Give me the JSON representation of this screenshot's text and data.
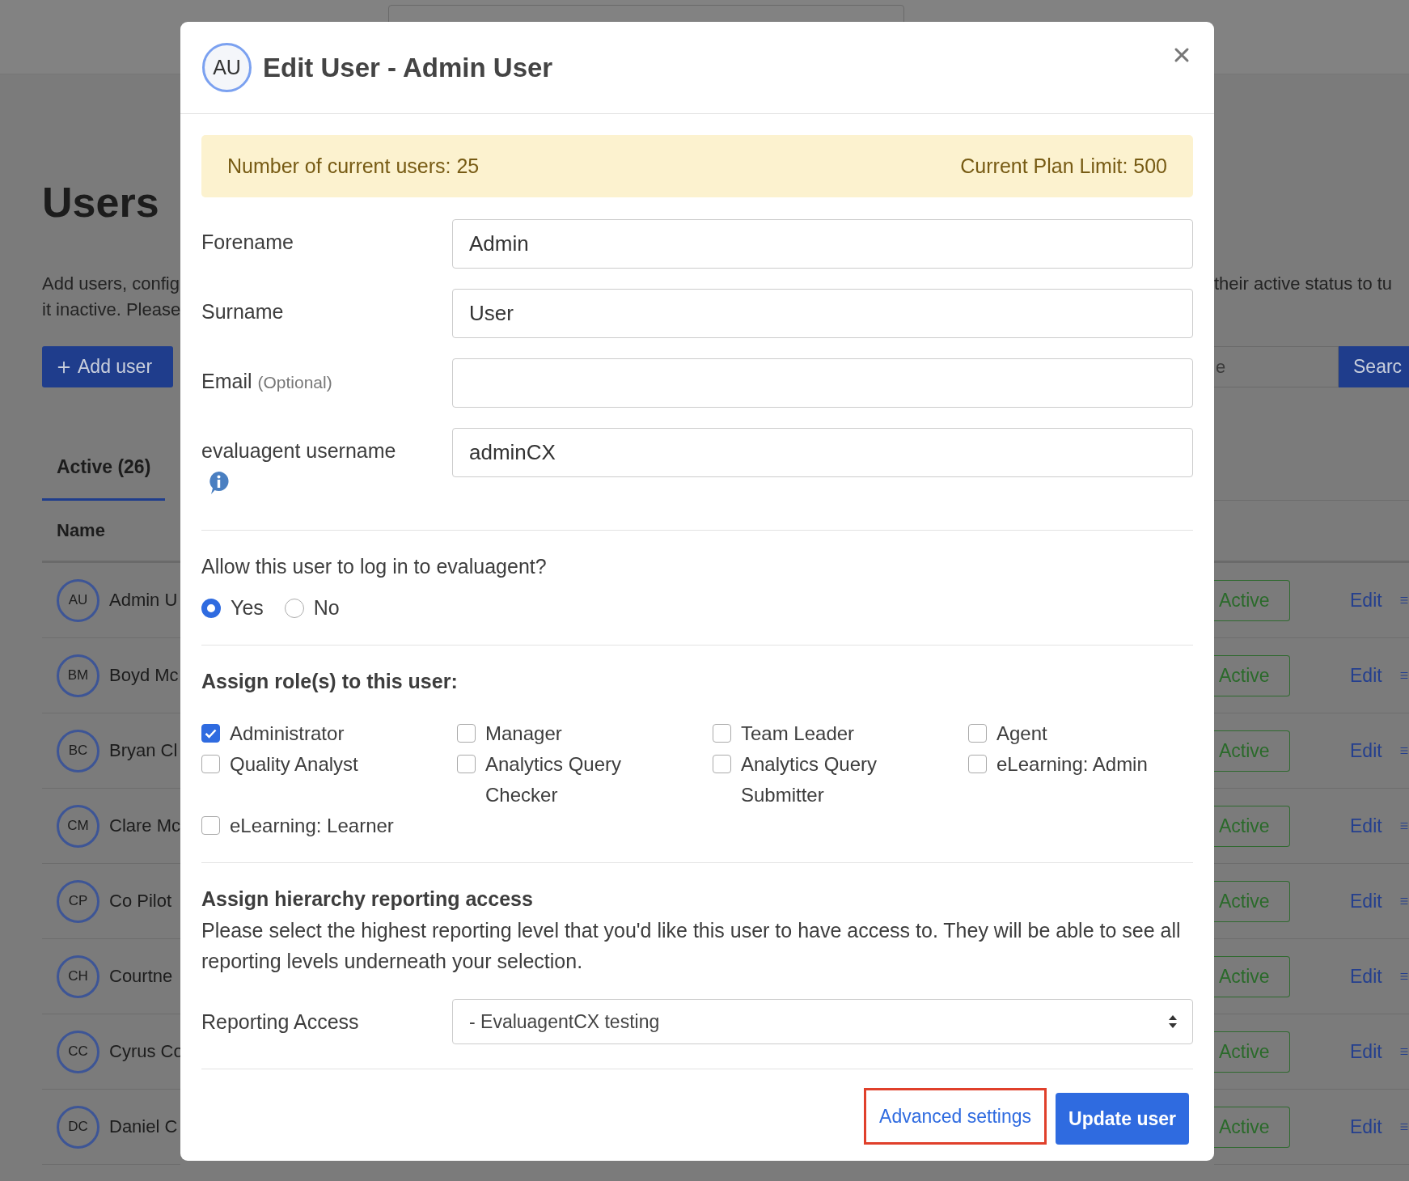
{
  "page": {
    "title": "Users",
    "description_left": [
      "Add users, config",
      "it inactive. Please"
    ],
    "description_right": "their active status to tu",
    "add_button": "Add user",
    "search": {
      "placeholder": "e",
      "button": "Searc"
    },
    "tabs": [
      {
        "label": "Active (26)",
        "selected": true
      }
    ],
    "table": {
      "columns": [
        "Name"
      ],
      "rows": [
        {
          "initials": "AU",
          "name": "Admin U",
          "status": "Active",
          "action": "Edit"
        },
        {
          "initials": "BM",
          "name": "Boyd Mc",
          "status": "Active",
          "action": "Edit"
        },
        {
          "initials": "BC",
          "name": "Bryan Cl",
          "status": "Active",
          "action": "Edit"
        },
        {
          "initials": "CM",
          "name": "Clare Mc",
          "status": "Active",
          "action": "Edit"
        },
        {
          "initials": "CP",
          "name": "Co Pilot",
          "status": "Active",
          "action": "Edit"
        },
        {
          "initials": "CH",
          "name": "Courtne",
          "status": "Active",
          "action": "Edit"
        },
        {
          "initials": "CC",
          "name": "Cyrus Co",
          "status": "Active",
          "action": "Edit"
        },
        {
          "initials": "DC",
          "name": "Daniel C",
          "status": "Active",
          "action": "Edit"
        }
      ]
    }
  },
  "modal": {
    "avatar": "AU",
    "title": "Edit User - Admin User",
    "alert": {
      "left": "Number of current users: 25",
      "right": "Current Plan Limit: 500"
    },
    "fields": [
      {
        "label": "Forename",
        "value": "Admin",
        "kind": "text"
      },
      {
        "label": "Surname",
        "value": "User",
        "kind": "text"
      },
      {
        "label": "Email",
        "hint": "(Optional)",
        "kind": "text"
      },
      {
        "label": "evaluagent username",
        "value": "adminCX",
        "kind": "text_with_info"
      }
    ],
    "login": {
      "question": "Allow this user to log in to evaluagent?",
      "options": [
        {
          "label": "Yes",
          "selected": true
        },
        {
          "label": "No",
          "selected": false
        }
      ]
    },
    "roles": {
      "title": "Assign role(s) to this user:",
      "items": [
        {
          "label": "Administrator",
          "checked": true
        },
        {
          "label": "Manager",
          "checked": false
        },
        {
          "label": "Team Leader",
          "checked": false
        },
        {
          "label": "Agent",
          "checked": false
        },
        {
          "label": "Quality Analyst",
          "checked": false
        },
        {
          "label": "Analytics Query Checker",
          "checked": false
        },
        {
          "label": "Analytics Query Submitter",
          "checked": false
        },
        {
          "label": "eLearning: Admin",
          "checked": false
        },
        {
          "label": "eLearning: Learner",
          "checked": false
        }
      ]
    },
    "hierarchy": {
      "title": "Assign hierarchy reporting access",
      "text": "Please select the highest reporting level that you'd like this user to have access to. They will be able to see all reporting levels underneath your selection.",
      "select": {
        "label": "Reporting Access",
        "value": "- EvaluagentCX testing"
      }
    },
    "footer": {
      "buttons": [
        {
          "label": "Advanced settings",
          "kind": "link",
          "highlighted": true
        },
        {
          "label": "Update user",
          "kind": "primary",
          "highlighted": false
        }
      ]
    }
  }
}
